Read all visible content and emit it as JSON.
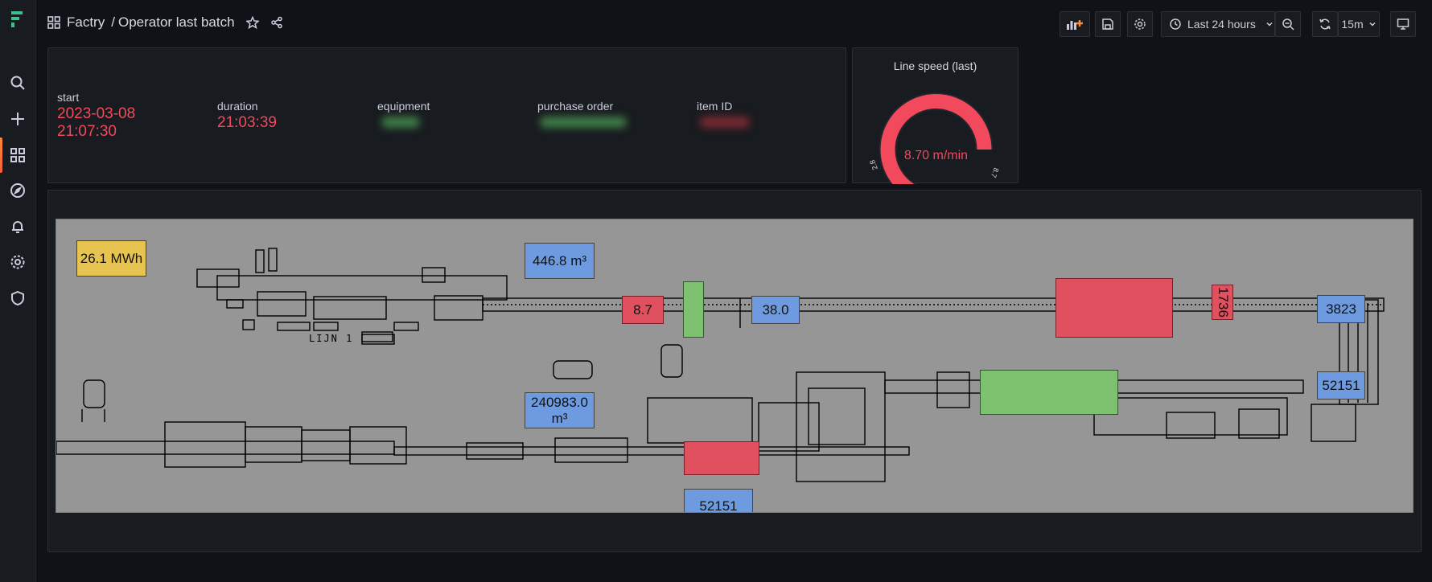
{
  "breadcrumb": {
    "folder": "Factry",
    "separator": "/",
    "title": "Operator last batch"
  },
  "toolbar": {
    "time_range": "Last 24 hours",
    "refresh_interval": "15m"
  },
  "stats": {
    "start_label": "start",
    "start_value_line1": "2023-03-08",
    "start_value_line2": "21:07:30",
    "duration_label": "duration",
    "duration_value": "21:03:39",
    "equipment_label": "equipment",
    "purchase_order_label": "purchase order",
    "item_id_label": "item ID"
  },
  "gauge": {
    "title": "Line speed (last)",
    "value_text": "8.70 m/min",
    "value": 8.7,
    "min": 2,
    "max": 8,
    "min_label": "2.8",
    "max_label": "8.7",
    "color": "#f2495c"
  },
  "diagram": {
    "energy": "26.1 MWh",
    "volume_top": "446.8 m³",
    "volume_mid_line1": "240983.0",
    "volume_mid_line2": "m³",
    "value_red_1": "8.7",
    "value_blue_1": "38.0",
    "value_red_vertical": "1736",
    "value_blue_right_top": "3823",
    "value_blue_right_mid": "52151",
    "value_blue_bottom": "52151",
    "line_label": "LIJN 1"
  },
  "colors": {
    "accent": "#f2495c",
    "background": "#111217",
    "panel": "#181b1f"
  }
}
